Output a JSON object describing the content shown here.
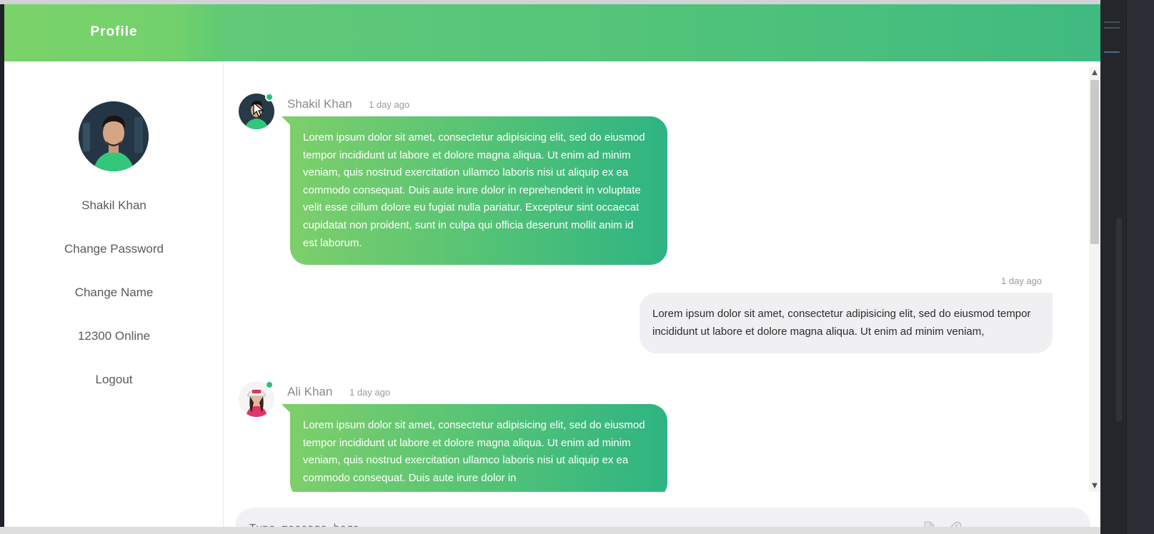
{
  "sidebar": {
    "title": "Profile",
    "user_name": "Shakil Khan",
    "items": [
      {
        "label": "Change Password"
      },
      {
        "label": "Change Name"
      },
      {
        "label": "12300 Online"
      },
      {
        "label": "Logout"
      }
    ]
  },
  "messages": [
    {
      "direction": "incoming",
      "sender": "Shakil Khan",
      "time": "1 day ago",
      "text": "Lorem ipsum dolor sit amet, consectetur adipisicing elit, sed do eiusmod tempor incididunt ut labore et dolore magna aliqua. Ut enim ad minim veniam, quis nostrud exercitation ullamco laboris nisi ut aliquip ex ea commodo consequat. Duis aute irure dolor in reprehenderit in voluptate velit esse cillum dolore eu fugiat nulla pariatur. Excepteur sint occaecat cupidatat non proident, sunt in culpa qui officia deserunt mollit anim id est laborum."
    },
    {
      "direction": "outgoing",
      "time": "1 day ago",
      "text": "Lorem ipsum dolor sit amet, consectetur adipisicing elit, sed do eiusmod tempor incididunt ut labore et dolore magna aliqua. Ut enim ad minim veniam,"
    },
    {
      "direction": "incoming",
      "sender": "Ali Khan",
      "time": "1 day ago",
      "text": "Lorem ipsum dolor sit amet, consectetur adipisicing elit, sed do eiusmod tempor incididunt ut labore et dolore magna aliqua. Ut enim ad minim veniam, quis nostrud exercitation ullamco laboris nisi ut aliquip ex ea commodo consequat. Duis aute irure dolor in"
    }
  ],
  "composer": {
    "placeholder": "Type message here",
    "icons": [
      "document-icon",
      "paperclip-icon"
    ]
  },
  "colors": {
    "brand_green": "#52c277",
    "online": "#2ebd85",
    "bubble_out": "#f0f0f2"
  }
}
